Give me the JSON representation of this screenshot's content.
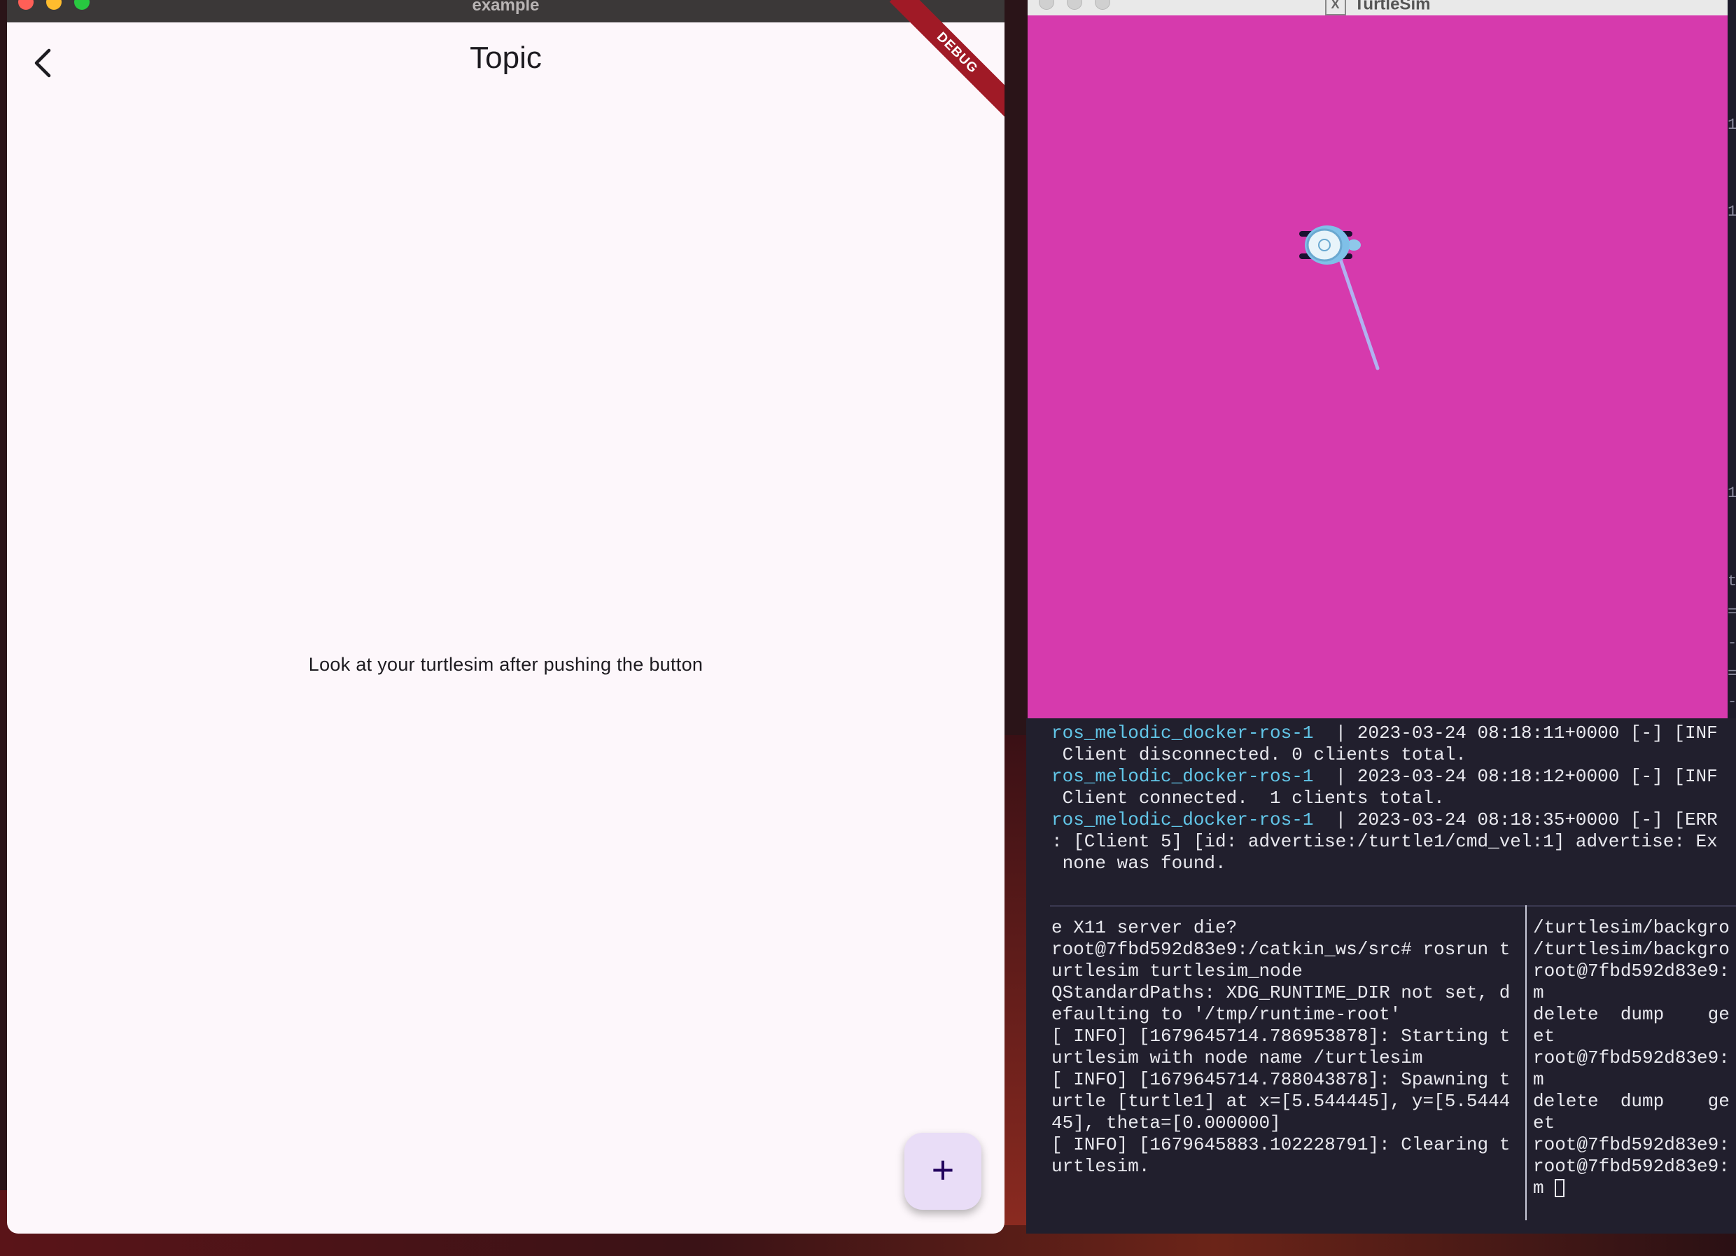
{
  "flutter_window": {
    "title": "example",
    "appbar_title": "Topic",
    "debug_banner": "DEBUG",
    "body_text": "Look at your turtlesim after pushing the button",
    "fab_label": "+"
  },
  "turtlesim_window": {
    "title": "TurtleSim",
    "background_color": "#d63aad",
    "pen_color": "#b0b2f0"
  },
  "terminal": {
    "log_lines": [
      {
        "source": "ros_melodic_docker-ros-1",
        "text": "  | 2023-03-24 08:18:11+0000 [-] [INF"
      },
      {
        "text": " Client disconnected. 0 clients total."
      },
      {
        "source": "ros_melodic_docker-ros-1",
        "text": "  | 2023-03-24 08:18:12+0000 [-] [INF"
      },
      {
        "text": " Client connected.  1 clients total."
      },
      {
        "source": "ros_melodic_docker-ros-1",
        "text": "  | 2023-03-24 08:18:35+0000 [-] [ERR"
      },
      {
        "text": ": [Client 5] [id: advertise:/turtle1/cmd_vel:1] advertise: Ex"
      },
      {
        "text": " none was found."
      }
    ],
    "left_pane": [
      "e X11 server die?",
      "root@7fbd592d83e9:/catkin_ws/src# rosrun t",
      "urtlesim turtlesim_node",
      "QStandardPaths: XDG_RUNTIME_DIR not set, d",
      "efaulting to '/tmp/runtime-root'",
      "[ INFO] [1679645714.786953878]: Starting t",
      "urtlesim with node name /turtlesim",
      "[ INFO] [1679645714.788043878]: Spawning t",
      "urtle [turtle1] at x=[5.544445], y=[5.5444",
      "45], theta=[0.000000]",
      "[ INFO] [1679645883.102228791]: Clearing t",
      "urtlesim."
    ],
    "right_pane": [
      "/turtlesim/backgro",
      "/turtlesim/backgro",
      "root@7fbd592d83e9:",
      "m",
      "delete  dump    ge",
      "et",
      "root@7fbd592d83e9:",
      "m",
      "delete  dump    ge",
      "et",
      "root@7fbd592d83e9:",
      "root@7fbd592d83e9:",
      "m "
    ]
  },
  "side_terminal_glyphs": [
    "1",
    "1",
    "1",
    "t",
    "=",
    "-",
    "=",
    "-"
  ]
}
